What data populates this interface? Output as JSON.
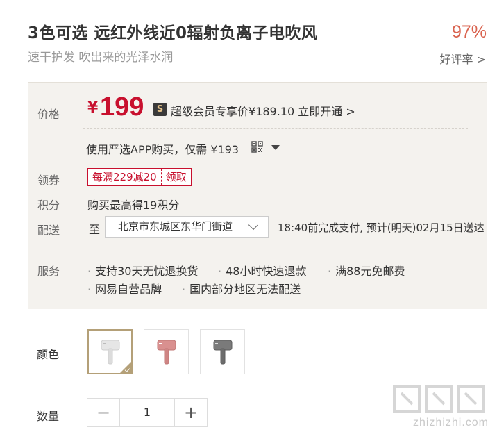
{
  "header": {
    "title": "3色可选 远红外线近0辐射负离子电吹风",
    "subtitle": "速干护发 吹出来的光泽水润",
    "rating_value": "97%",
    "rating_link": "好评率 >"
  },
  "panel": {
    "price_label": "价格",
    "price_currency": "¥",
    "price_value": "199",
    "vip_icon_glyph": "S",
    "vip_text": "超级会员专享价¥189.10 立即开通 >",
    "app_text": "使用严选APP购买，仅需 ¥193",
    "coupon_label": "领券",
    "coupon_left": "每满229减20",
    "coupon_right": "领取",
    "points_label": "积分",
    "points_text": "购买最高得19积分",
    "ship_label": "配送",
    "ship_to": "至",
    "ship_address": "北京市东城区东华门街道",
    "ship_info": "18:40前完成支付, 预计(明天)02月15日送达",
    "service_label": "服务",
    "services": [
      "支持30天无忧退换货",
      "48小时快速退款",
      "满88元免邮费",
      "网易自营品牌",
      "国内部分地区无法配送"
    ]
  },
  "color": {
    "label": "颜色",
    "options": [
      {
        "name": "white",
        "color": "#e8e8e8",
        "accent": "#cfcfcf"
      },
      {
        "name": "pink",
        "color": "#d9908f",
        "accent": "#c07776"
      },
      {
        "name": "gray",
        "color": "#7a7a7a",
        "accent": "#5e5e5e"
      }
    ],
    "selected_index": 0
  },
  "quantity": {
    "label": "数量",
    "minus": "−",
    "value": "1",
    "plus": "+"
  },
  "watermark": {
    "text": "zhizhizhi.com"
  },
  "colors": {
    "price_red": "#c8102e",
    "rating_orange": "#d9624e",
    "panel_bg": "#f4f2ee",
    "selected_border": "#b4a078"
  }
}
